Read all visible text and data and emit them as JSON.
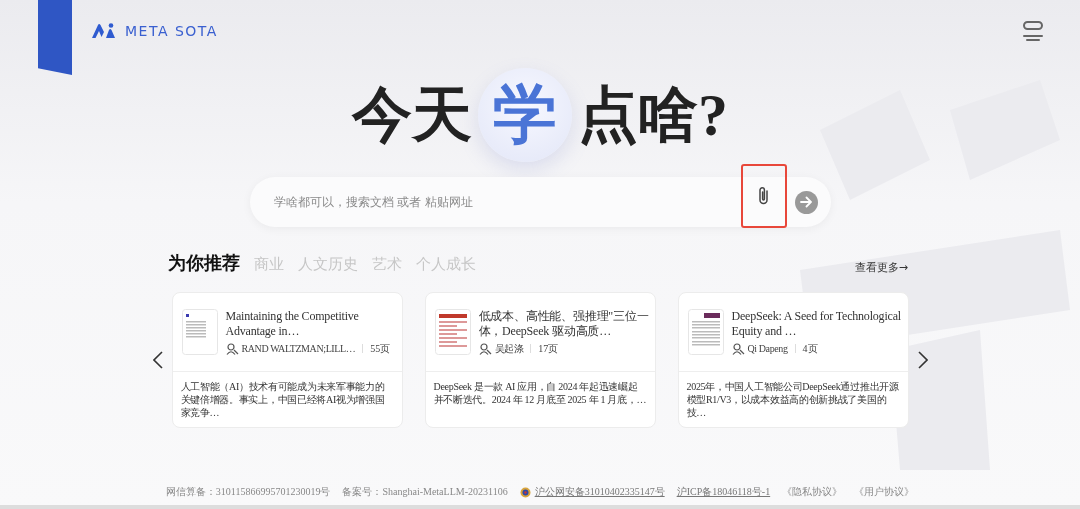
{
  "header": {
    "logo": "META SOTA"
  },
  "hero": {
    "before": "今天",
    "highlight": "学",
    "after": "点啥?"
  },
  "search": {
    "placeholder": "学啥都可以，搜索文档 或者 粘贴网址",
    "attach_highlighted": true
  },
  "recommend": {
    "tabs": [
      {
        "label": "为你推荐",
        "selected": true
      },
      {
        "label": "商业",
        "selected": false
      },
      {
        "label": "人文历史",
        "selected": false
      },
      {
        "label": "艺术",
        "selected": false
      },
      {
        "label": "个人成长",
        "selected": false
      }
    ],
    "more": "查看更多→",
    "cards": [
      {
        "title": "Maintaining the Competitive Advantage in…",
        "author": "RAND WALTZMAN;LILL…",
        "pages": "55页",
        "summary": "人工智能（AI）技术有可能成为未来军事能力的关键倍增器。事实上，中国已经将AI视为增强国家竞争…"
      },
      {
        "title": "低成本、高性能、强推理\"三位一体，DeepSeek 驱动高质…",
        "author": "吴起涤",
        "pages": "17页",
        "summary": "DeepSeek 是一款 AI 应用，自 2024 年起迅速崛起并不断迭代。2024 年 12 月底至 2025 年 1 月底，…"
      },
      {
        "title": "DeepSeek: A Seed for Technological Equity and …",
        "author": "Qi Dapeng",
        "pages": "4页",
        "summary": "2025年，中国人工智能公司DeepSeek通过推出开源模型R1/V3，以成本效益高的创新挑战了美国的技…"
      }
    ]
  },
  "footer": [
    {
      "kind": "text",
      "text": "网信算备：310115866995701230019号"
    },
    {
      "kind": "text",
      "text": "备案号：Shanghai-MetaLLM-20231106"
    },
    {
      "kind": "badge-link",
      "text": "沪公网安备31010402335147号"
    },
    {
      "kind": "link",
      "text": "沪ICP备18046118号-1"
    },
    {
      "kind": "text",
      "text": "《隐私协议》"
    },
    {
      "kind": "text",
      "text": "《用户协议》"
    }
  ]
}
